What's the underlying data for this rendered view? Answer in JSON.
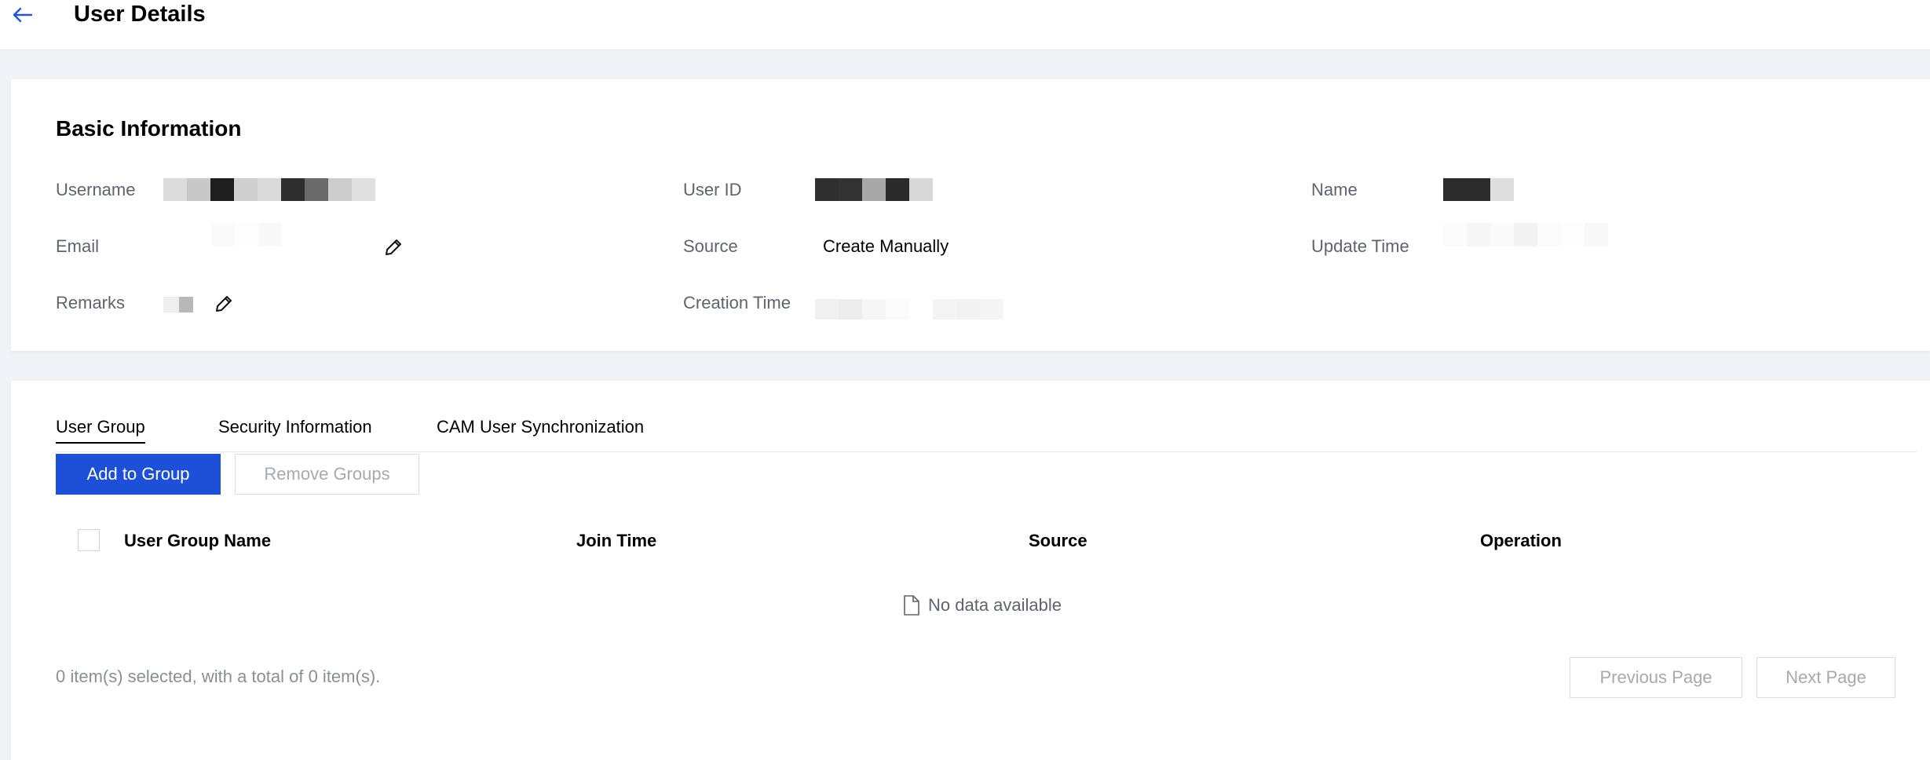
{
  "header": {
    "title": "User Details",
    "back_icon": "arrow-left-icon",
    "accent": "#2255d8"
  },
  "basic": {
    "title": "Basic Information",
    "fields": {
      "username": {
        "label": "Username",
        "value_redacted": true
      },
      "email": {
        "label": "Email",
        "value_redacted": true
      },
      "remarks": {
        "label": "Remarks",
        "value_redacted": true
      },
      "user_id": {
        "label": "User ID",
        "value_redacted": true
      },
      "source": {
        "label": "Source",
        "value": "Create Manually"
      },
      "creation_time": {
        "label": "Creation Time",
        "value_redacted": true
      },
      "name": {
        "label": "Name",
        "value_redacted": true
      },
      "update_time": {
        "label": "Update Time",
        "value_redacted": true
      }
    },
    "edit_icon": "pencil-icon"
  },
  "tabs": {
    "items": [
      "User Group",
      "Security Information",
      "CAM User Synchronization"
    ],
    "active": "User Group"
  },
  "toolbar": {
    "add_label": "Add to Group",
    "remove_label": "Remove Groups",
    "primary_color": "#1e4fd8"
  },
  "table": {
    "columns": [
      "User Group Name",
      "Join Time",
      "Source",
      "Operation"
    ],
    "rows": [],
    "empty_text": "No data available",
    "empty_icon": "document-icon"
  },
  "footer": {
    "summary": "0 item(s) selected, with a total of 0 item(s).",
    "prev_label": "Previous Page",
    "next_label": "Next Page"
  }
}
